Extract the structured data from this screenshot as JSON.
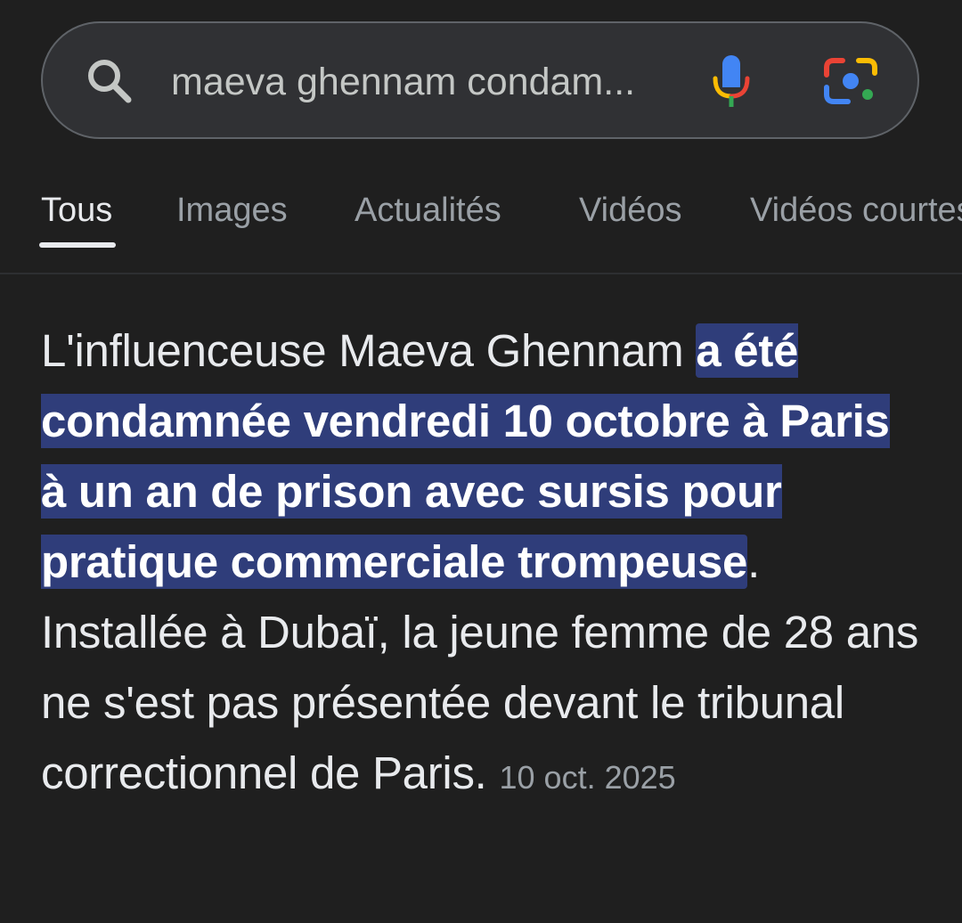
{
  "search": {
    "query": "maeva ghennam condam..."
  },
  "icons": {
    "search": "search-icon",
    "mic": "mic-icon",
    "lens": "google-lens-icon"
  },
  "colors": {
    "background": "#1f1f1f",
    "search_bar": "#303134",
    "highlight": "#2f3d7a",
    "mic_blue": "#4285f4",
    "mic_red": "#ea4335",
    "mic_yellow": "#fbbc04",
    "mic_green": "#34a853"
  },
  "tabs": [
    {
      "label": "Tous",
      "active": true
    },
    {
      "label": "Images",
      "active": false
    },
    {
      "label": "Actualités",
      "active": false
    },
    {
      "label": "Vidéos",
      "active": false
    },
    {
      "label": "Vidéos courtes",
      "active": false
    }
  ],
  "snippet": {
    "lead": "L'influenceuse Maeva Ghennam ",
    "highlight": "a été condamnée vendredi 10 octobre à Paris à un an de prison avec sursis pour pratique commerciale trompeuse",
    "rest": ". Installée à Dubaï, la jeune femme de 28 ans ne s'est pas présentée devant le tribunal correctionnel de Paris.",
    "date": "10 oct. 2025"
  }
}
